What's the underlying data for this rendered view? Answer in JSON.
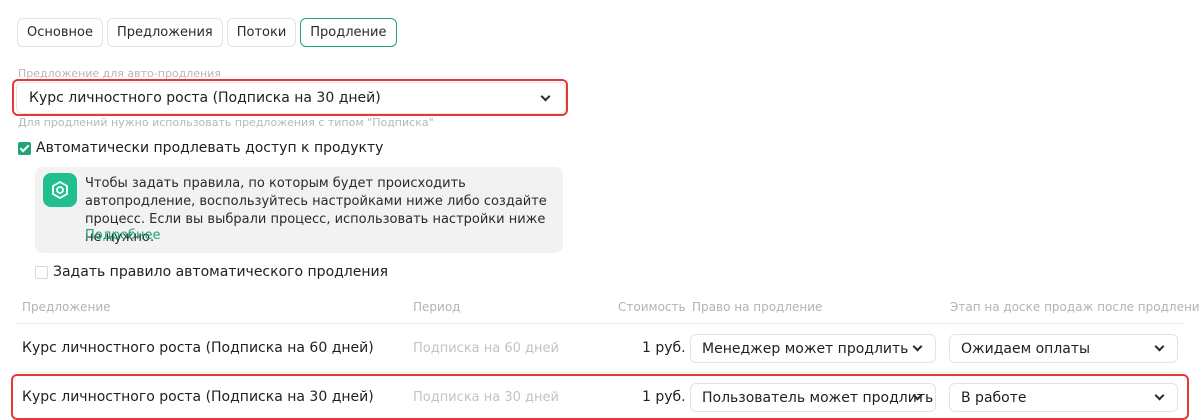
{
  "tabs": [
    {
      "label": "Основное"
    },
    {
      "label": "Предложения"
    },
    {
      "label": "Потоки"
    },
    {
      "label": "Продление",
      "active": true
    }
  ],
  "renewal_offer": {
    "label": "Предложение для авто-продления",
    "value": "Курс личностного роста (Подписка на 30 дней)",
    "hint": "Для продлений нужно использовать предложения с типом \"Подписка\""
  },
  "auto_renew": {
    "label": "Автоматически продлевать доступ к продукту",
    "checked": true
  },
  "info": {
    "text": "Чтобы задать правила, по которым будет происходить автопродление, воспользуйтесь настройками ниже либо создайте процесс. Если вы выбрали процесс, использовать настройки ниже не нужно.",
    "link": "Подробнее",
    "icon": "hexagon-nut-icon"
  },
  "rule": {
    "label": "Задать правило автоматического продления",
    "checked": false
  },
  "table": {
    "headers": {
      "offer": "Предложение",
      "period": "Период",
      "cost": "Стоимость",
      "right": "Право на продление",
      "stage": "Этап на доске продаж после продления"
    },
    "rows": [
      {
        "offer": "Курс личностного роста (Подписка на 60 дней)",
        "period": "Подписка на 60 дней",
        "cost": "1 руб.",
        "right": "Менеджер может продлить",
        "stage": "Ожидаем оплаты"
      },
      {
        "offer": "Курс личностного роста (Подписка на 30 дней)",
        "period": "Подписка на 30 дней",
        "cost": "1 руб.",
        "right": "Пользователь может продлить",
        "stage": "В работе"
      }
    ]
  },
  "colors": {
    "accent": "#1fa47a",
    "highlight": "#e53935"
  }
}
